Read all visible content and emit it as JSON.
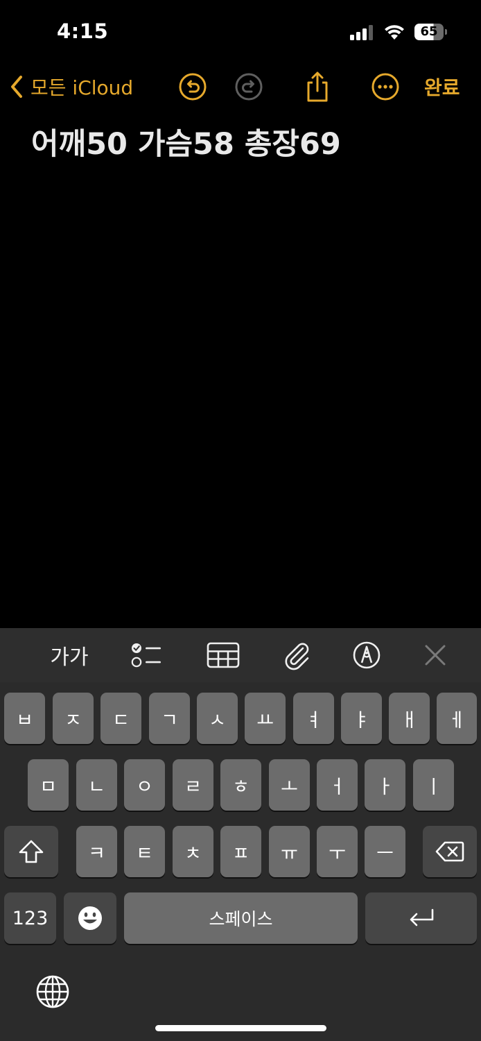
{
  "status_bar": {
    "time": "4:15",
    "battery_level": "65"
  },
  "nav": {
    "back_label": "모든 iCloud",
    "done_label": "완료"
  },
  "note": {
    "text": "어깨50 가슴58 총장69"
  },
  "toolbar": {
    "format_label": "가가"
  },
  "keyboard": {
    "row1": [
      "ㅂ",
      "ㅈ",
      "ㄷ",
      "ㄱ",
      "ㅅ",
      "ㅛ",
      "ㅕ",
      "ㅑ",
      "ㅐ",
      "ㅔ"
    ],
    "row2": [
      "ㅁ",
      "ㄴ",
      "ㅇ",
      "ㄹ",
      "ㅎ",
      "ㅗ",
      "ㅓ",
      "ㅏ",
      "ㅣ"
    ],
    "row3": [
      "ㅋ",
      "ㅌ",
      "ㅊ",
      "ㅍ",
      "ㅠ",
      "ㅜ",
      "ㅡ"
    ],
    "numbers_label": "123",
    "space_label": "스페이스"
  },
  "colors": {
    "accent": "#e6a92c",
    "key": "#6c6c6c",
    "key_dark": "#464646",
    "keyboard_bg": "#2b2b2b"
  }
}
